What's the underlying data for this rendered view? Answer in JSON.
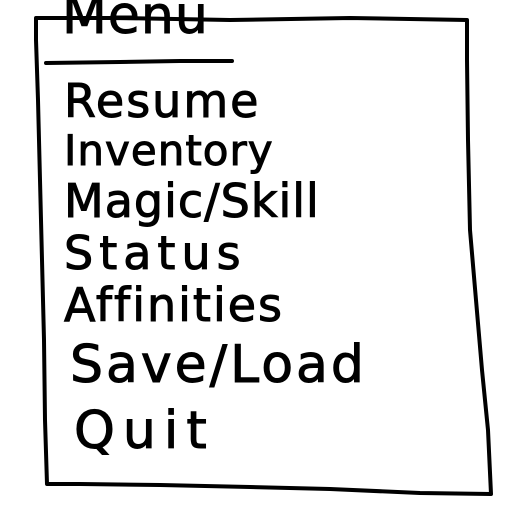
{
  "menu": {
    "title": "Menu",
    "items": [
      {
        "label": "Resume"
      },
      {
        "label": "Inventory"
      },
      {
        "label": "Magic/Skill"
      },
      {
        "label": "Status"
      },
      {
        "label": "Affinities"
      },
      {
        "label": "Save/Load"
      },
      {
        "label": "Quit"
      }
    ]
  }
}
